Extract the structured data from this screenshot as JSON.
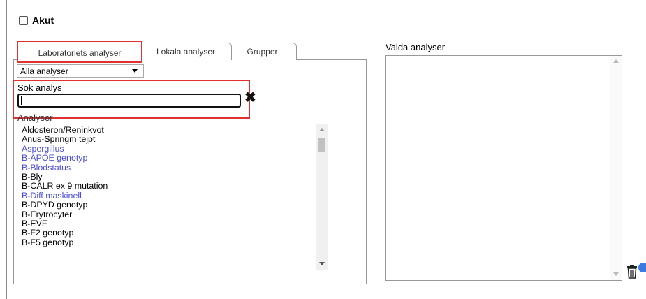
{
  "akut": {
    "label": "Akut",
    "checked": false
  },
  "tabs": [
    {
      "label": "Laboratoriets analyser",
      "active": true
    },
    {
      "label": "Lokala analyser",
      "active": false
    },
    {
      "label": "Grupper",
      "active": false
    }
  ],
  "filter": {
    "selected": "Alla analyser"
  },
  "search": {
    "label": "Sök analys",
    "value": ""
  },
  "analyses": {
    "label": "Analyser",
    "items": [
      {
        "label": "Aldosteron/Reninkvot",
        "color": "#000000"
      },
      {
        "label": "Anus-Springm tejpt",
        "color": "#000000"
      },
      {
        "label": "Aspergillus",
        "color": "#4a4ed8"
      },
      {
        "label": "B-APOE genotyp",
        "color": "#4a4ed8"
      },
      {
        "label": "B-Blodstatus",
        "color": "#4a4ed8"
      },
      {
        "label": "B-Bly",
        "color": "#000000"
      },
      {
        "label": "B-CALR ex 9 mutation",
        "color": "#000000"
      },
      {
        "label": "B-Diff maskinell",
        "color": "#4a4ed8"
      },
      {
        "label": "B-DPYD genotyp",
        "color": "#000000"
      },
      {
        "label": "B-Erytrocyter",
        "color": "#000000"
      },
      {
        "label": "B-EVF",
        "color": "#000000"
      },
      {
        "label": "B-F2 genotyp",
        "color": "#000000"
      },
      {
        "label": "B-F5 genotyp",
        "color": "#000000"
      }
    ]
  },
  "selected": {
    "label": "Valda analyser"
  },
  "icons": {
    "clear": "close-icon",
    "trash": "trash-icon",
    "info": "info-icon"
  },
  "colors": {
    "highlight": "#e03030",
    "link": "#4a4ed8"
  }
}
